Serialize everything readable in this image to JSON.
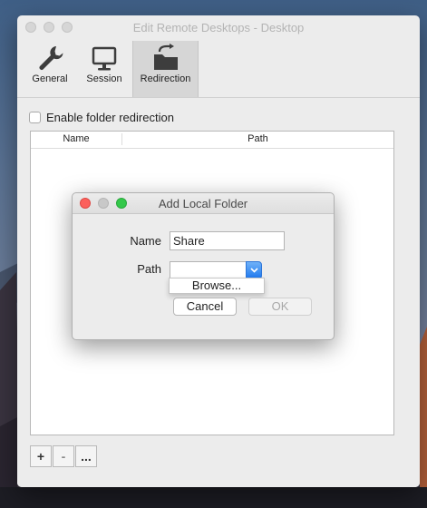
{
  "window": {
    "title": "Edit Remote Desktops - Desktop",
    "tabs": [
      {
        "label": "General",
        "icon": "wrench-icon"
      },
      {
        "label": "Session",
        "icon": "monitor-icon"
      },
      {
        "label": "Redirection",
        "icon": "folder-redirect-icon",
        "selected": true
      }
    ]
  },
  "redirection": {
    "enable_label": "Enable folder redirection",
    "enable_checked": false,
    "table": {
      "columns": [
        "Name",
        "Path"
      ],
      "rows": []
    },
    "buttons": {
      "add": "+",
      "remove": "-",
      "more": "..."
    }
  },
  "dialog": {
    "title": "Add Local Folder",
    "name_label": "Name",
    "name_value": "Share",
    "path_label": "Path",
    "path_value": "",
    "path_menu": [
      "Browse..."
    ],
    "cancel_label": "Cancel",
    "ok_label": "OK",
    "ok_enabled": false
  },
  "colors": {
    "close": "#fc605c",
    "minimize": "#c8c8c8",
    "zoom": "#34c84a",
    "accent": "#1e78ee"
  }
}
